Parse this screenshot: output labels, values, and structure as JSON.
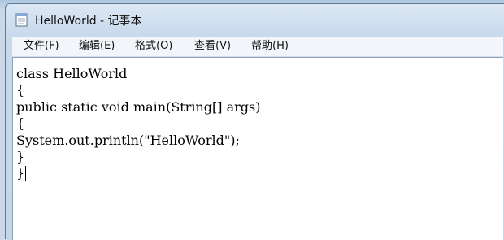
{
  "window": {
    "title": "HelloWorld - 记事本"
  },
  "menu": {
    "items": [
      {
        "label": "文件(F)"
      },
      {
        "label": "编辑(E)"
      },
      {
        "label": "格式(O)"
      },
      {
        "label": "查看(V)"
      },
      {
        "label": "帮助(H)"
      }
    ]
  },
  "editor": {
    "lines": [
      "class HelloWorld",
      "{",
      "public static void main(String[] args)",
      "{",
      "System.out.println(\"HelloWorld\");",
      "}",
      "}"
    ]
  },
  "icons": {
    "app": "notepad-icon"
  }
}
